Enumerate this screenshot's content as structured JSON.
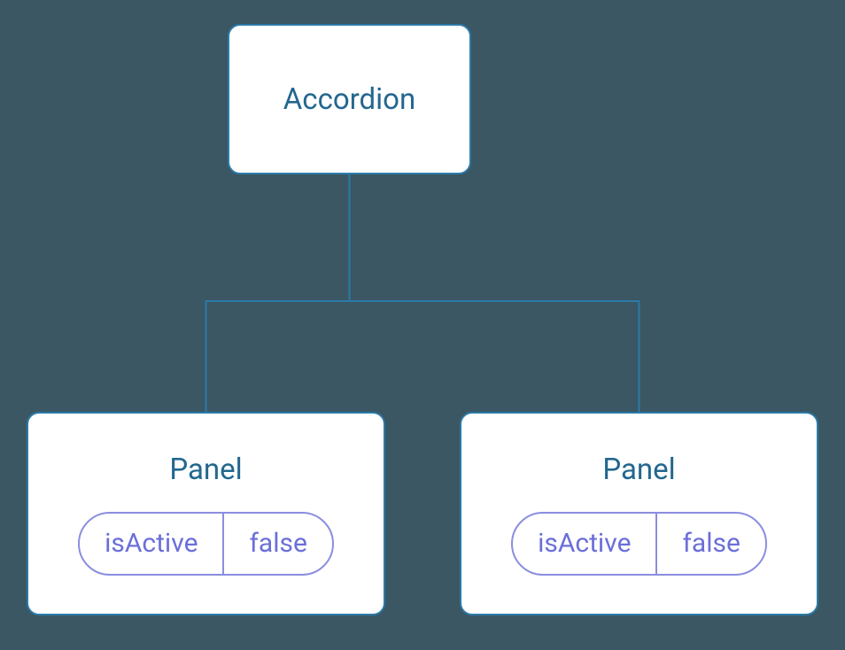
{
  "root": {
    "title": "Accordion"
  },
  "children": [
    {
      "title": "Panel",
      "prop": {
        "name": "isActive",
        "value": "false"
      }
    },
    {
      "title": "Panel",
      "prop": {
        "name": "isActive",
        "value": "false"
      }
    }
  ],
  "colors": {
    "background": "#3a5763",
    "nodeBorder": "#2b7aa8",
    "nodeText": "#23678f",
    "pillBorder": "#8b8ee0",
    "pillText": "#6b6fd8"
  }
}
